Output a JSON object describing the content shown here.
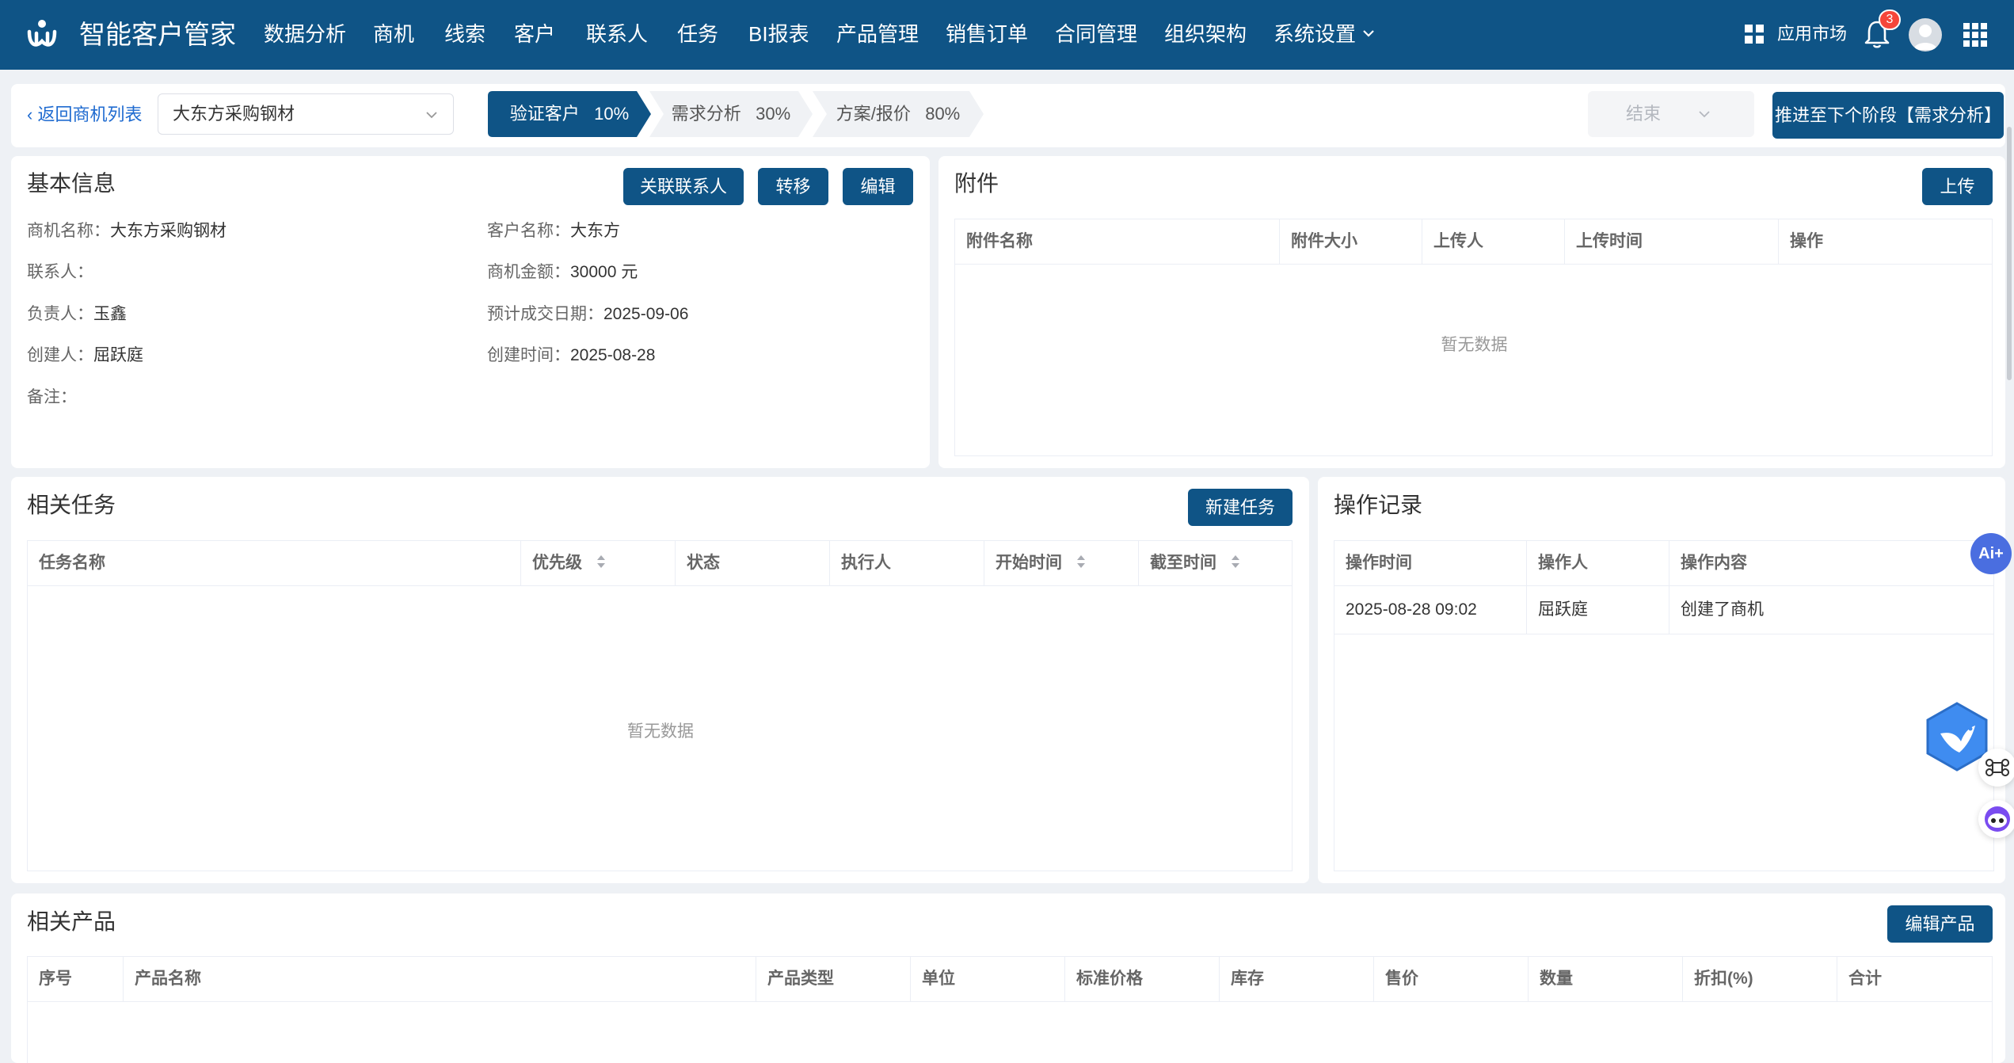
{
  "app": {
    "title": "智能客户管家"
  },
  "nav": {
    "items": [
      "数据分析",
      "商机",
      "线索",
      "客户",
      "联系人",
      "任务",
      "BI报表",
      "产品管理",
      "销售订单",
      "合同管理",
      "组织架构",
      "系统设置"
    ],
    "appstore": "应用市场",
    "notification_count": "3"
  },
  "stagebar": {
    "back": "返回商机列表",
    "opportunity_select": "大东方采购钢材",
    "stages": [
      {
        "name": "验证客户",
        "pct": "10%",
        "active": true
      },
      {
        "name": "需求分析",
        "pct": "30%",
        "active": false
      },
      {
        "name": "方案/报价",
        "pct": "80%",
        "active": false
      }
    ],
    "end_select": "结束",
    "advance_button": "推进至下个阶段【需求分析】"
  },
  "basic_info": {
    "title": "基本信息",
    "buttons": {
      "link_contact": "关联联系人",
      "transfer": "转移",
      "edit": "编辑"
    },
    "fields": {
      "opp_name_label": "商机名称：",
      "opp_name": "大东方采购钢材",
      "customer_label": "客户名称：",
      "customer": "大东方",
      "contact_label": "联系人：",
      "contact": "",
      "amount_label": "商机金额：",
      "amount": "30000 元",
      "owner_label": "负责人：",
      "owner": "玉鑫",
      "close_date_label": "预计成交日期：",
      "close_date": "2025-09-06",
      "creator_label": "创建人：",
      "creator": "屈跃庭",
      "created_label": "创建时间：",
      "created": "2025-08-28",
      "remark_label": "备注：",
      "remark": ""
    }
  },
  "attachments": {
    "title": "附件",
    "upload_button": "上传",
    "columns": [
      "附件名称",
      "附件大小",
      "上传人",
      "上传时间",
      "操作"
    ],
    "empty": "暂无数据"
  },
  "tasks": {
    "title": "相关任务",
    "new_button": "新建任务",
    "columns": [
      "任务名称",
      "优先级",
      "状态",
      "执行人",
      "开始时间",
      "截至时间"
    ],
    "empty": "暂无数据"
  },
  "logs": {
    "title": "操作记录",
    "columns": [
      "操作时间",
      "操作人",
      "操作内容"
    ],
    "rows": [
      {
        "time": "2025-08-28 09:02",
        "operator": "屈跃庭",
        "content": "创建了商机"
      }
    ]
  },
  "products": {
    "title": "相关产品",
    "edit_button": "编辑产品",
    "columns": [
      "序号",
      "产品名称",
      "产品类型",
      "单位",
      "标准价格",
      "库存",
      "售价",
      "数量",
      "折扣(%)",
      "合计"
    ]
  },
  "floating": {
    "ai_label": "Ai+"
  },
  "colors": {
    "primary": "#0f5486",
    "link": "#1f6bd0",
    "badge": "#f5463a",
    "stage_inactive": "#f0f2f5"
  }
}
